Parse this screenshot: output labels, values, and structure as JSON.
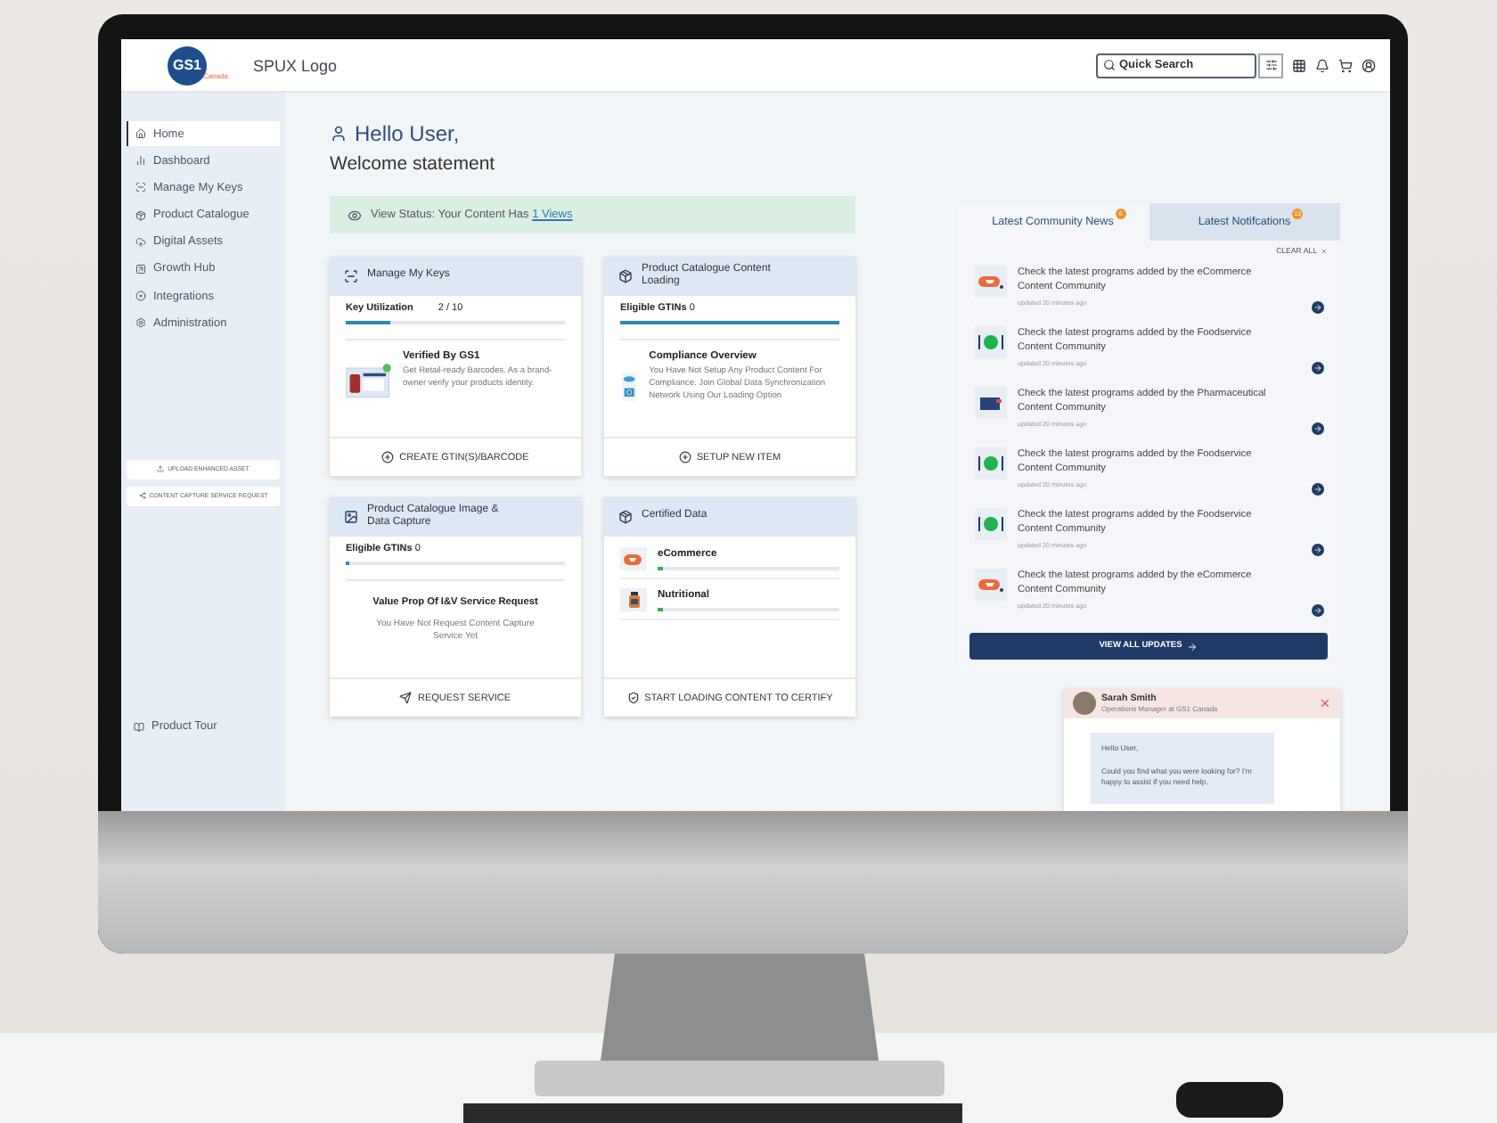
{
  "header": {
    "logo_mark": "GS1",
    "logo_sub": "Canada",
    "title": "SPUX Logo",
    "search": {
      "placeholder": "Quick Search"
    }
  },
  "sidebar": {
    "items": [
      {
        "label": "Home",
        "selected": true
      },
      {
        "label": "Dashboard",
        "selected": false
      },
      {
        "label": "Manage My Keys",
        "selected": false
      },
      {
        "label": "Product Catalogue",
        "selected": false
      },
      {
        "label": "Digital Assets",
        "selected": false
      },
      {
        "label": "Growth Hub",
        "selected": false
      },
      {
        "label": "Integrations",
        "selected": false
      },
      {
        "label": "Administration",
        "selected": false
      }
    ],
    "actions": [
      "UPLOAD ENHANCED ASSET",
      "CONTENT CAPTURE SERVICE REQUEST"
    ],
    "footer": "Product Tour"
  },
  "greeting": {
    "title": "Hello User,",
    "subtitle": "Welcome statement"
  },
  "status": {
    "text": "View Status: Your Content Has",
    "link": "1 Views"
  },
  "cards": [
    {
      "kind": "keys",
      "title": "Manage My Keys",
      "metric_label": "Key Utilization",
      "metric_value": "2 / 10",
      "level": 0.2,
      "info_title": "Verified By GS1",
      "info_text": "Get Retail-ready Barcodes. As a brand-owner verify your products identity.",
      "action": "CREATE GTIN(S)/BARCODE"
    },
    {
      "kind": "loading",
      "title": "Product Catalogue Content Loading",
      "metric_label": "**Eligible GTINs** 0",
      "level": 1,
      "info_title": "Compliance Overview",
      "info_text": "You Have Not Setup Any Product Content For Compliance. Join Global Data Synchronization Network Using Our Loading Option",
      "action": "SETUP NEW ITEM"
    },
    {
      "kind": "capture",
      "title": "Product Catalogue Image & Data Capture",
      "metric_label": "**Eligible GTINs** 0",
      "level": 0.02,
      "info_title": "Value Prop Of I&V Service Request",
      "info_text": "You Have Not Request Content Capture Service Yet",
      "action": "REQUEST SERVICE"
    },
    {
      "kind": "certified",
      "title": "Certified Data",
      "items": [
        {
          "kind": "ecommerce",
          "label": "eCommerce",
          "level": 0.03
        },
        {
          "kind": "nutritional",
          "label": "Nutritional",
          "level": 0.03
        }
      ],
      "action": "START LOADING CONTENT TO CERTIFY"
    }
  ],
  "news": {
    "tabs": [
      {
        "label": "Latest Community News",
        "badge": "6",
        "selected": true
      },
      {
        "label": "Latest Notifcations",
        "badge": "12",
        "selected": false
      }
    ],
    "clear": "CLEAR ALL",
    "items": [
      {
        "kind": "ecommerce",
        "text": "Check the latest programs added by the eCommerce Content Community",
        "time": "updated 20 minutes ago"
      },
      {
        "kind": "foodservice",
        "text": "Check the latest programs added by the Foodservice Content Community",
        "time": "updated 20 minutes ago"
      },
      {
        "kind": "pharmaceutical",
        "text": "Check the latest programs added by the Pharmaceutical Content Community",
        "time": "updated 20 minutes ago"
      },
      {
        "kind": "foodservice",
        "text": "Check the latest programs added by the Foodservice Content Community",
        "time": "updated 20 minutes ago"
      },
      {
        "kind": "foodservice",
        "text": "Check the latest programs added by the Foodservice Content Community",
        "time": "updated 20 minutes ago"
      },
      {
        "kind": "ecommerce",
        "text": "Check the latest programs added by the eCommerce Content Community",
        "time": "updated 20 minutes ago"
      }
    ],
    "button": "VIEW ALL UPDATES"
  },
  "chat": {
    "name": "Sarah Smith",
    "role": "Operations Manager at GS1 Canada",
    "messages": [
      "Hello User,",
      "Could you find what you were looking for? I'm happy to assist if you need help."
    ]
  }
}
